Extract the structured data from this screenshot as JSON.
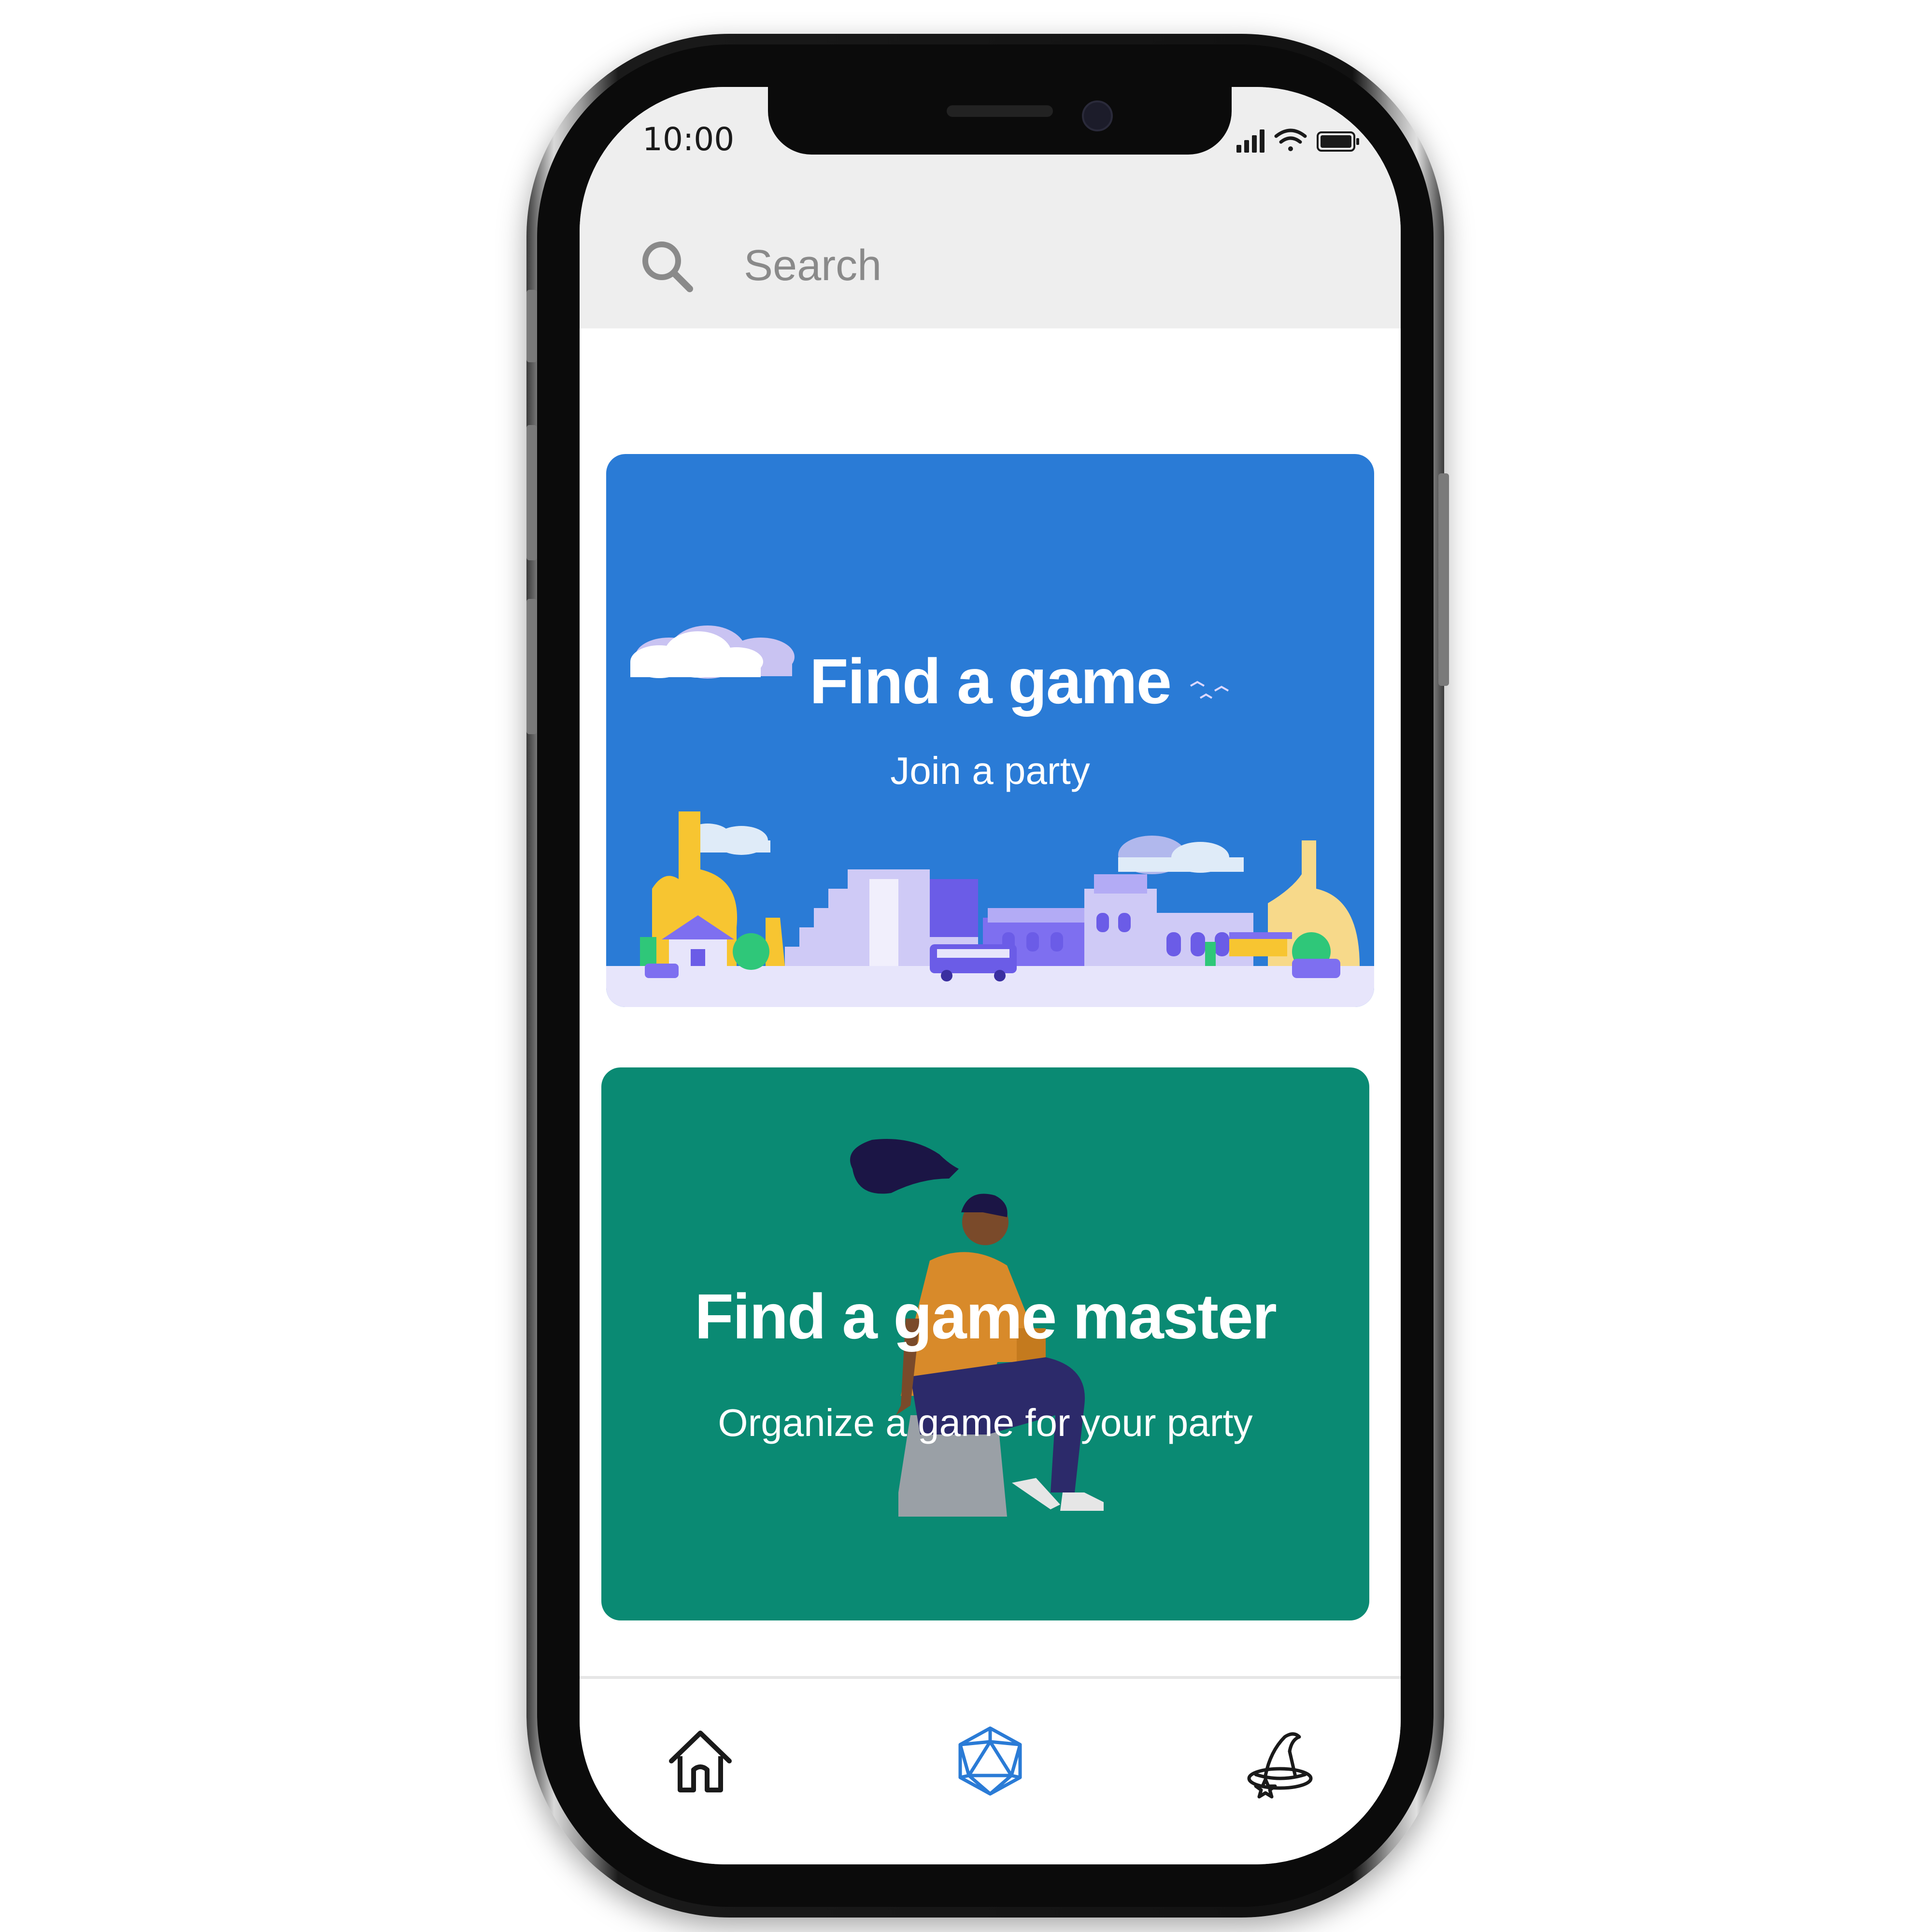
{
  "status_bar": {
    "time": "10:00"
  },
  "search": {
    "placeholder": "Search"
  },
  "cards": [
    {
      "title": "Find a game",
      "subtitle": "Join a party",
      "color": "#2a7bd6"
    },
    {
      "title": "Find a game master",
      "subtitle": "Organize a game for your party",
      "color": "#0a8a73"
    }
  ],
  "tab_bar": {
    "items": [
      {
        "icon": "home-icon",
        "active": false
      },
      {
        "icon": "d20-dice-icon",
        "active": true
      },
      {
        "icon": "wizard-hat-icon",
        "active": false
      }
    ],
    "active_color": "#2a7bd6"
  }
}
